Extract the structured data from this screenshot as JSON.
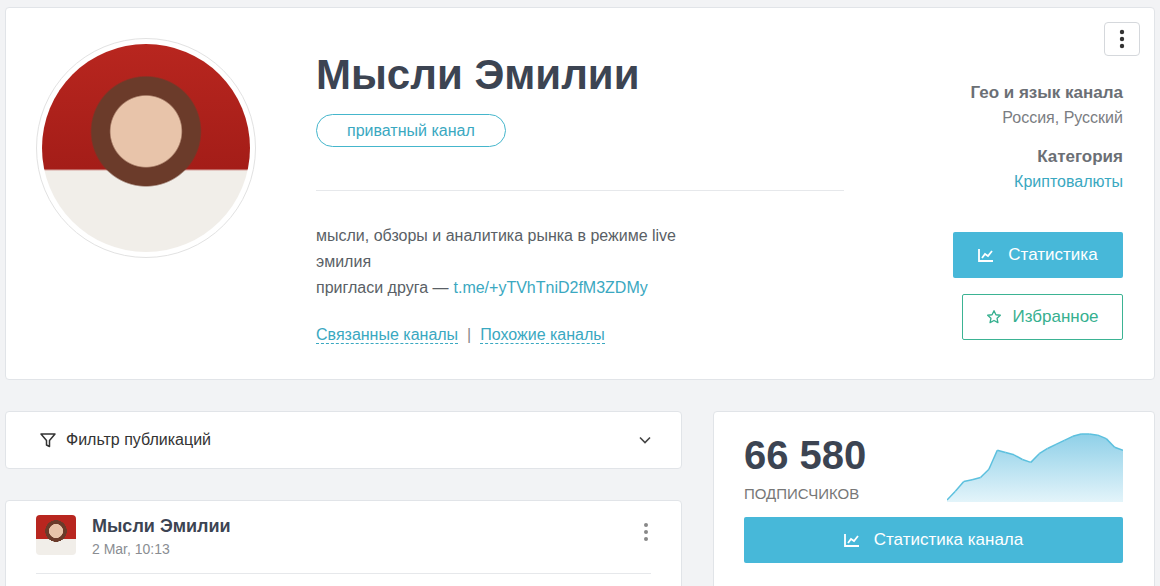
{
  "channel": {
    "title": "Мысли Эмилии",
    "badge": "приватный канал",
    "description": [
      "мысли, обзоры и аналитика рынка в режиме live",
      "эмилия"
    ],
    "invite_label": "пригласи друга —",
    "invite_link": "t.me/+yTVhTniD2fM3ZDMy",
    "links": [
      "Связанные каналы",
      "Похожие каналы"
    ],
    "separator": "|"
  },
  "meta": [
    {
      "label": "Гео и язык канала",
      "value": "Россия, Русский",
      "link": false
    },
    {
      "label": "Категория",
      "value": "Криптовалюты",
      "link": true
    }
  ],
  "buttons": {
    "stats": "Статистика",
    "favorite": "Избранное"
  },
  "filter": {
    "label": "Фильтр публикаций"
  },
  "posts": [
    {
      "author": "Мысли Эмилии",
      "time": "2 Mar, 10:13"
    }
  ],
  "stats": {
    "subscribers": "66 580",
    "label": "ПОДПИСЧИКОВ",
    "button": "Статистика канала",
    "chart": {
      "values": [
        58000,
        59500,
        61200,
        61500,
        61900,
        63300,
        66600,
        66200,
        65800,
        65000,
        64500,
        66000,
        66900,
        67600,
        68300,
        69000,
        69400,
        69400,
        69200,
        68600,
        67100,
        66580
      ]
    }
  }
}
